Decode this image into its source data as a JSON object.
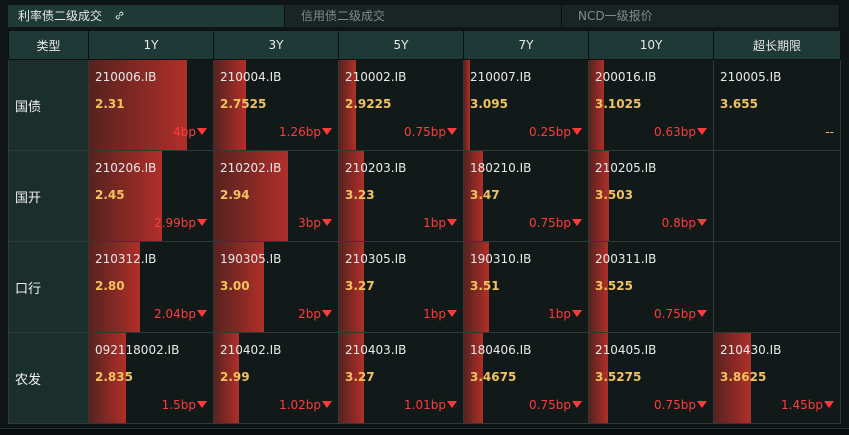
{
  "tabs": [
    {
      "label": "利率债二级成交",
      "active": true
    },
    {
      "label": "信用债二级成交",
      "active": false
    },
    {
      "label": "NCD一级报价",
      "active": false
    }
  ],
  "link_icon": "link-icon",
  "columns": [
    "类型",
    "1Y",
    "3Y",
    "5Y",
    "7Y",
    "10Y",
    "超长期限"
  ],
  "colors": {
    "accent_header": "#1f3a36",
    "yield": "#f2c35a",
    "change_down": "#ff3b3b",
    "bar": "#b9302a"
  },
  "rows": [
    {
      "type": "国债",
      "cells": [
        {
          "code": "210006.IB",
          "yield": "2.31",
          "change": "4bp",
          "dir": "down",
          "level": 0.79
        },
        {
          "code": "210004.IB",
          "yield": "2.7525",
          "change": "1.26bp",
          "dir": "down",
          "level": 0.26
        },
        {
          "code": "210002.IB",
          "yield": "2.9225",
          "change": "0.75bp",
          "dir": "down",
          "level": 0.14
        },
        {
          "code": "210007.IB",
          "yield": "3.095",
          "change": "0.25bp",
          "dir": "down",
          "level": 0.05
        },
        {
          "code": "200016.IB",
          "yield": "3.1025",
          "change": "0.63bp",
          "dir": "down",
          "level": 0.12
        },
        {
          "code": "210005.IB",
          "yield": "3.655",
          "change": "--",
          "dir": "none",
          "level": 0
        }
      ]
    },
    {
      "type": "国开",
      "cells": [
        {
          "code": "210206.IB",
          "yield": "2.45",
          "change": "2.99bp",
          "dir": "down",
          "level": 0.59
        },
        {
          "code": "210202.IB",
          "yield": "2.94",
          "change": "3bp",
          "dir": "down",
          "level": 0.6
        },
        {
          "code": "210203.IB",
          "yield": "3.23",
          "change": "1bp",
          "dir": "down",
          "level": 0.2
        },
        {
          "code": "180210.IB",
          "yield": "3.47",
          "change": "0.75bp",
          "dir": "down",
          "level": 0.15
        },
        {
          "code": "210205.IB",
          "yield": "3.503",
          "change": "0.8bp",
          "dir": "down",
          "level": 0.16
        },
        null
      ]
    },
    {
      "type": "口行",
      "cells": [
        {
          "code": "210312.IB",
          "yield": "2.80",
          "change": "2.04bp",
          "dir": "down",
          "level": 0.41
        },
        {
          "code": "190305.IB",
          "yield": "3.00",
          "change": "2bp",
          "dir": "down",
          "level": 0.4
        },
        {
          "code": "210305.IB",
          "yield": "3.27",
          "change": "1bp",
          "dir": "down",
          "level": 0.2
        },
        {
          "code": "190310.IB",
          "yield": "3.51",
          "change": "1bp",
          "dir": "down",
          "level": 0.2
        },
        {
          "code": "200311.IB",
          "yield": "3.525",
          "change": "0.75bp",
          "dir": "down",
          "level": 0.15
        },
        null
      ]
    },
    {
      "type": "农发",
      "cells": [
        {
          "code": "092118002.IB",
          "yield": "2.835",
          "change": "1.5bp",
          "dir": "down",
          "level": 0.3
        },
        {
          "code": "210402.IB",
          "yield": "2.99",
          "change": "1.02bp",
          "dir": "down",
          "level": 0.2
        },
        {
          "code": "210403.IB",
          "yield": "3.27",
          "change": "1.01bp",
          "dir": "down",
          "level": 0.2
        },
        {
          "code": "180406.IB",
          "yield": "3.4675",
          "change": "0.75bp",
          "dir": "down",
          "level": 0.15
        },
        {
          "code": "210405.IB",
          "yield": "3.5275",
          "change": "0.75bp",
          "dir": "down",
          "level": 0.15
        },
        {
          "code": "210430.IB",
          "yield": "3.8625",
          "change": "1.45bp",
          "dir": "down",
          "level": 0.29
        }
      ]
    }
  ]
}
